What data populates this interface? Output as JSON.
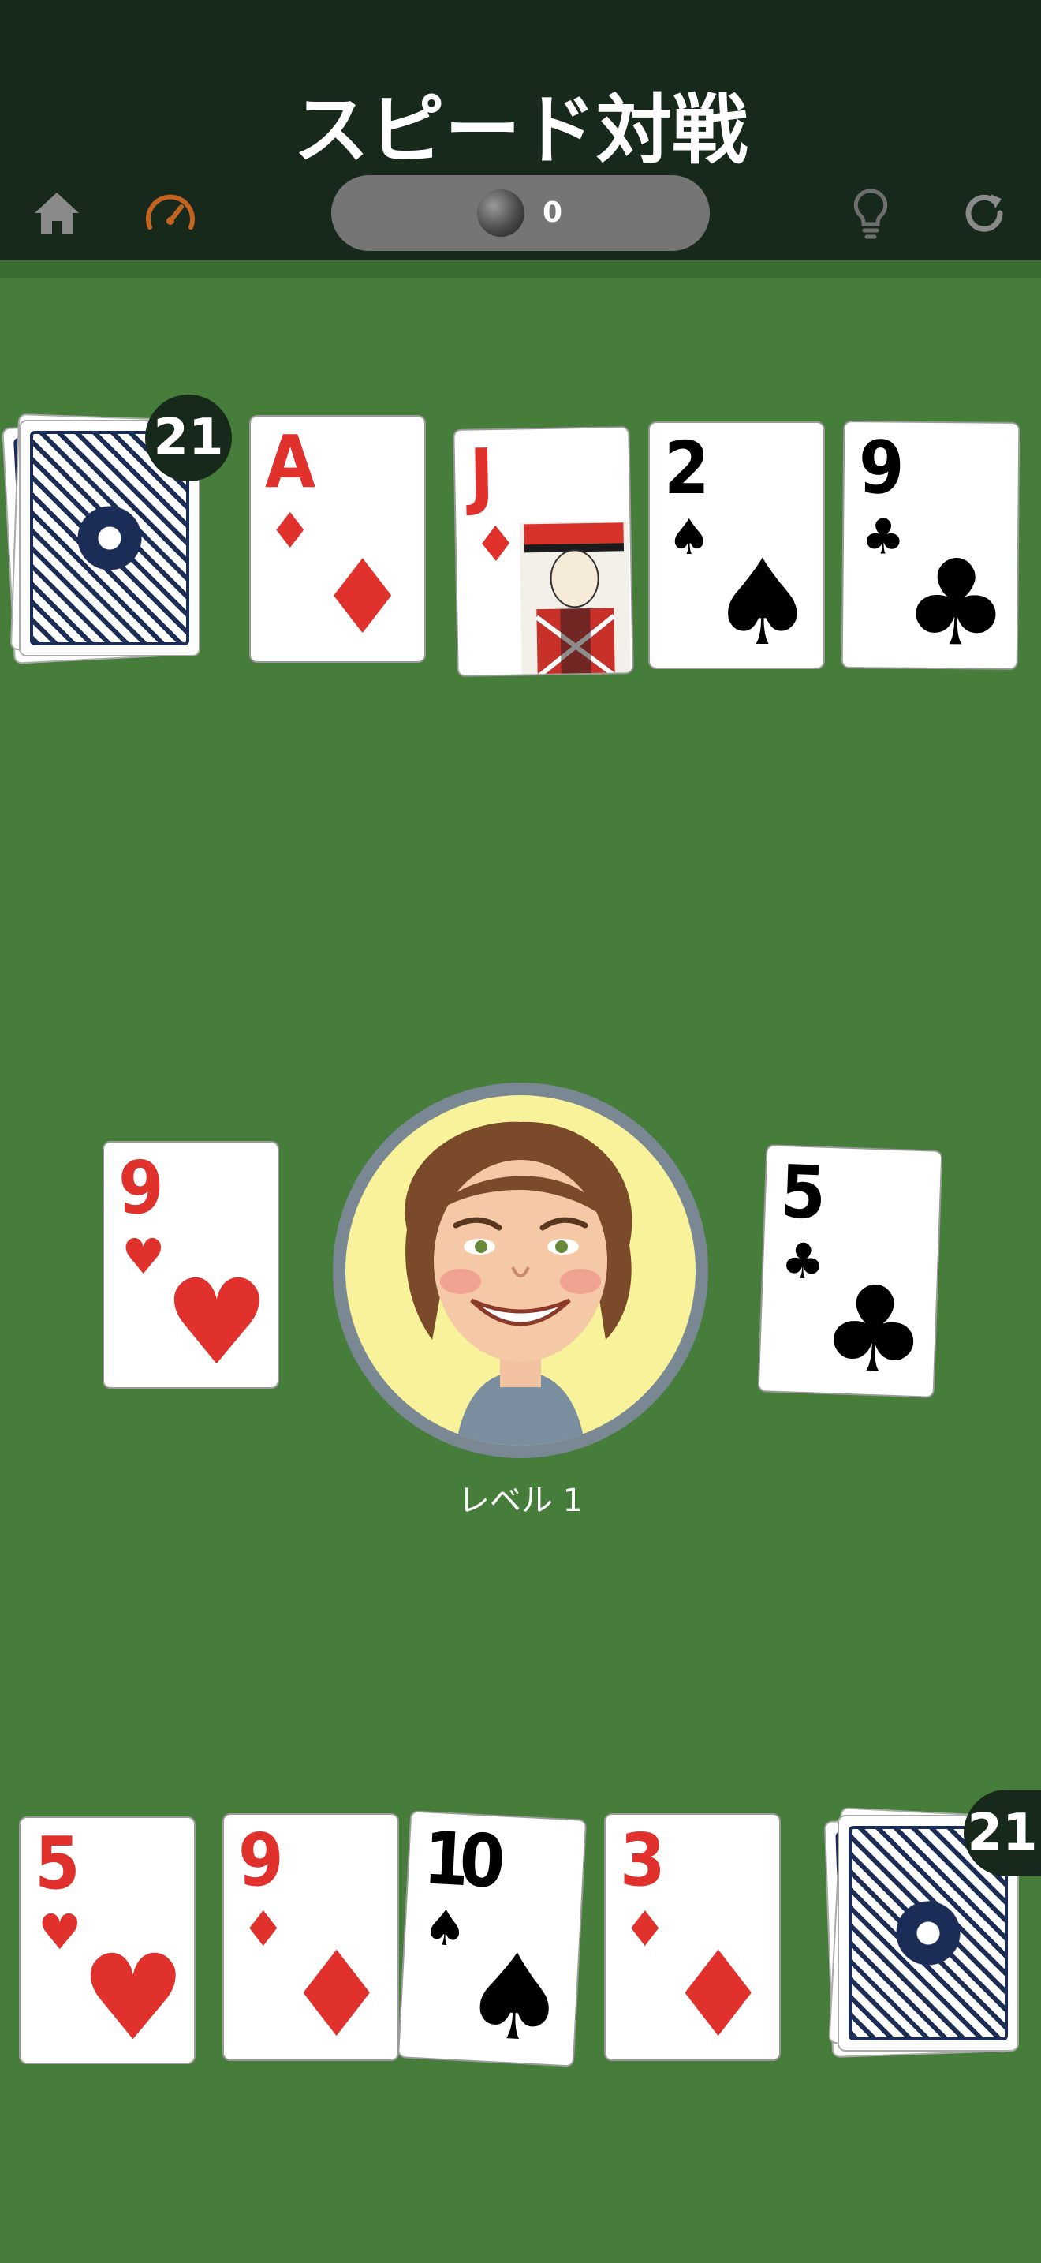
{
  "header": {
    "title": "スピード対戦",
    "score": "0",
    "icons": [
      "home-icon",
      "speedometer-icon",
      "coin-icon",
      "lightbulb-icon",
      "restart-icon"
    ]
  },
  "colors": {
    "felt": "#477d3a",
    "header": "#16291a",
    "red_suit": "#e0312c",
    "speed_icon": "#c4621f"
  },
  "opponent": {
    "deck_count": "21",
    "hand": [
      {
        "rank": "A",
        "suit": "♦",
        "color": "red"
      },
      {
        "rank": "J",
        "suit": "♦",
        "color": "red"
      },
      {
        "rank": "2",
        "suit": "♠",
        "color": "black"
      },
      {
        "rank": "9",
        "suit": "♣",
        "color": "black"
      }
    ]
  },
  "center": {
    "left_pile": {
      "rank": "9",
      "suit": "♥",
      "color": "red"
    },
    "right_pile": {
      "rank": "5",
      "suit": "♣",
      "color": "black"
    },
    "level_label": "レベル 1"
  },
  "player": {
    "deck_count": "21",
    "hand": [
      {
        "rank": "5",
        "suit": "♥",
        "color": "red"
      },
      {
        "rank": "9",
        "suit": "♦",
        "color": "red"
      },
      {
        "rank": "10",
        "suit": "♠",
        "color": "black"
      },
      {
        "rank": "3",
        "suit": "♦",
        "color": "red"
      }
    ]
  }
}
